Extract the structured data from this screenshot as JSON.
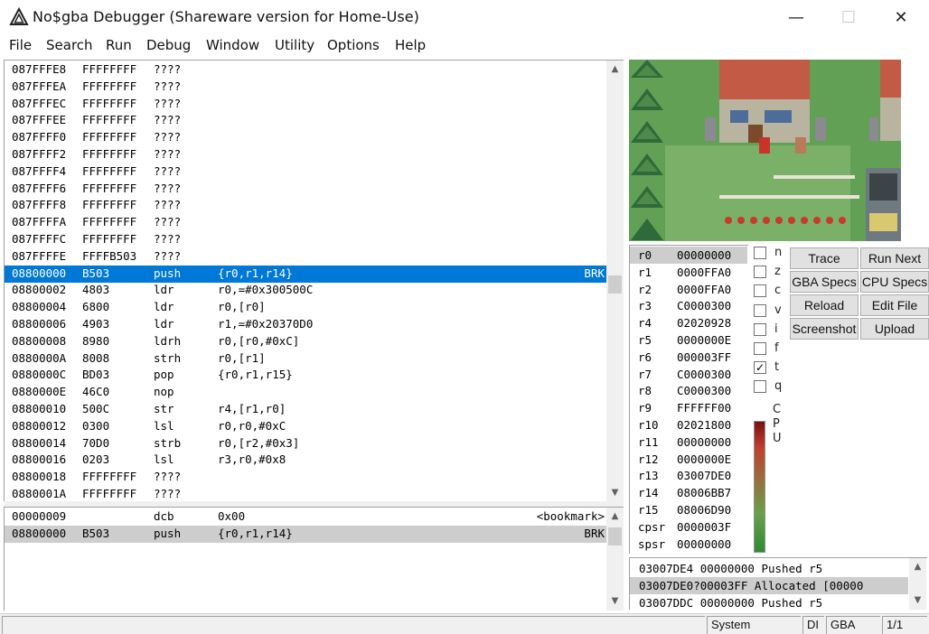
{
  "window": {
    "title": "No$gba Debugger (Shareware version for Home-Use)",
    "minimize": "—",
    "maximize": "☐",
    "close": "✕"
  },
  "menu": [
    "File",
    "Search",
    "Run",
    "Debug",
    "Window",
    "Utility",
    "Options",
    "Help"
  ],
  "disassembly": [
    {
      "addr": "087FFFE8",
      "code": "FFFFFFFF",
      "mnem": "????",
      "ops": "",
      "mark": ""
    },
    {
      "addr": "087FFFEA",
      "code": "FFFFFFFF",
      "mnem": "????",
      "ops": "",
      "mark": ""
    },
    {
      "addr": "087FFFEC",
      "code": "FFFFFFFF",
      "mnem": "????",
      "ops": "",
      "mark": ""
    },
    {
      "addr": "087FFFEE",
      "code": "FFFFFFFF",
      "mnem": "????",
      "ops": "",
      "mark": ""
    },
    {
      "addr": "087FFFF0",
      "code": "FFFFFFFF",
      "mnem": "????",
      "ops": "",
      "mark": ""
    },
    {
      "addr": "087FFFF2",
      "code": "FFFFFFFF",
      "mnem": "????",
      "ops": "",
      "mark": ""
    },
    {
      "addr": "087FFFF4",
      "code": "FFFFFFFF",
      "mnem": "????",
      "ops": "",
      "mark": ""
    },
    {
      "addr": "087FFFF6",
      "code": "FFFFFFFF",
      "mnem": "????",
      "ops": "",
      "mark": ""
    },
    {
      "addr": "087FFFF8",
      "code": "FFFFFFFF",
      "mnem": "????",
      "ops": "",
      "mark": ""
    },
    {
      "addr": "087FFFFA",
      "code": "FFFFFFFF",
      "mnem": "????",
      "ops": "",
      "mark": ""
    },
    {
      "addr": "087FFFFC",
      "code": "FFFFFFFF",
      "mnem": "????",
      "ops": "",
      "mark": ""
    },
    {
      "addr": "087FFFFE",
      "code": "FFFFB503",
      "mnem": "????",
      "ops": "",
      "mark": ""
    },
    {
      "addr": "08800000",
      "code": "B503",
      "mnem": "push",
      "ops": "{r0,r1,r14}",
      "mark": "BRK"
    },
    {
      "addr": "08800002",
      "code": "4803",
      "mnem": "ldr",
      "ops": "r0,=#0x300500C",
      "mark": ""
    },
    {
      "addr": "08800004",
      "code": "6800",
      "mnem": "ldr",
      "ops": "r0,[r0]",
      "mark": ""
    },
    {
      "addr": "08800006",
      "code": "4903",
      "mnem": "ldr",
      "ops": "r1,=#0x20370D0",
      "mark": ""
    },
    {
      "addr": "08800008",
      "code": "8980",
      "mnem": "ldrh",
      "ops": "r0,[r0,#0xC]",
      "mark": ""
    },
    {
      "addr": "0880000A",
      "code": "8008",
      "mnem": "strh",
      "ops": "r0,[r1]",
      "mark": ""
    },
    {
      "addr": "0880000C",
      "code": "BD03",
      "mnem": "pop",
      "ops": "{r0,r1,r15}",
      "mark": ""
    },
    {
      "addr": "0880000E",
      "code": "46C0",
      "mnem": "nop",
      "ops": "",
      "mark": ""
    },
    {
      "addr": "08800010",
      "code": "500C",
      "mnem": "str",
      "ops": "r4,[r1,r0]",
      "mark": ""
    },
    {
      "addr": "08800012",
      "code": "0300",
      "mnem": "lsl",
      "ops": "r0,r0,#0xC",
      "mark": ""
    },
    {
      "addr": "08800014",
      "code": "70D0",
      "mnem": "strb",
      "ops": "r0,[r2,#0x3]",
      "mark": ""
    },
    {
      "addr": "08800016",
      "code": "0203",
      "mnem": "lsl",
      "ops": "r3,r0,#0x8",
      "mark": ""
    },
    {
      "addr": "08800018",
      "code": "FFFFFFFF",
      "mnem": "????",
      "ops": "",
      "mark": ""
    },
    {
      "addr": "0880001A",
      "code": "FFFFFFFF",
      "mnem": "????",
      "ops": "",
      "mark": ""
    }
  ],
  "bookmarks": [
    {
      "addr": "00000009",
      "code": "",
      "mnem": "dcb",
      "ops": "0x00",
      "mark": "<bookmark>"
    },
    {
      "addr": "08800000",
      "code": "B503",
      "mnem": "push",
      "ops": "{r0,r1,r14}",
      "mark": "BRK"
    }
  ],
  "registers": [
    {
      "name": "r0",
      "value": "00000000"
    },
    {
      "name": "r1",
      "value": "0000FFA0"
    },
    {
      "name": "r2",
      "value": "0000FFA0"
    },
    {
      "name": "r3",
      "value": "C0000300"
    },
    {
      "name": "r4",
      "value": "02020928"
    },
    {
      "name": "r5",
      "value": "0000000E"
    },
    {
      "name": "r6",
      "value": "000003FF"
    },
    {
      "name": "r7",
      "value": "C0000300"
    },
    {
      "name": "r8",
      "value": "C0000300"
    },
    {
      "name": "r9",
      "value": "FFFFFF00"
    },
    {
      "name": "r10",
      "value": "02021800"
    },
    {
      "name": "r11",
      "value": "00000000"
    },
    {
      "name": "r12",
      "value": "0000000E"
    },
    {
      "name": "r13",
      "value": "03007DE0"
    },
    {
      "name": "r14",
      "value": "08006BB7"
    },
    {
      "name": "r15",
      "value": "08006D90"
    },
    {
      "name": "cpsr",
      "value": "0000003F"
    },
    {
      "name": "spsr",
      "value": "00000000"
    }
  ],
  "flags": [
    {
      "label": "n",
      "checked": false
    },
    {
      "label": "z",
      "checked": false
    },
    {
      "label": "c",
      "checked": false
    },
    {
      "label": "v",
      "checked": false
    },
    {
      "label": "i",
      "checked": false
    },
    {
      "label": "f",
      "checked": false
    },
    {
      "label": "t",
      "checked": true
    },
    {
      "label": "q",
      "checked": false
    }
  ],
  "cpu_letters": [
    "C",
    "P",
    "U"
  ],
  "buttons": [
    "Trace",
    "Run Next",
    "GBA Specs",
    "CPU Specs",
    "Reload",
    "Edit File",
    "Screenshot",
    "Upload"
  ],
  "stack_log": [
    "03007DE4 00000000 Pushed r5",
    "03007DE0?00003FF Allocated [00000",
    "03007DDC 00000000 Pushed r5"
  ],
  "status": {
    "blank": "",
    "mode": "System",
    "di": "DI",
    "system": "GBA",
    "page": "1/1"
  },
  "colors": {
    "selection": "#0078d7",
    "grey_selection": "#cdcdcd",
    "button": "#e1e1e1"
  }
}
